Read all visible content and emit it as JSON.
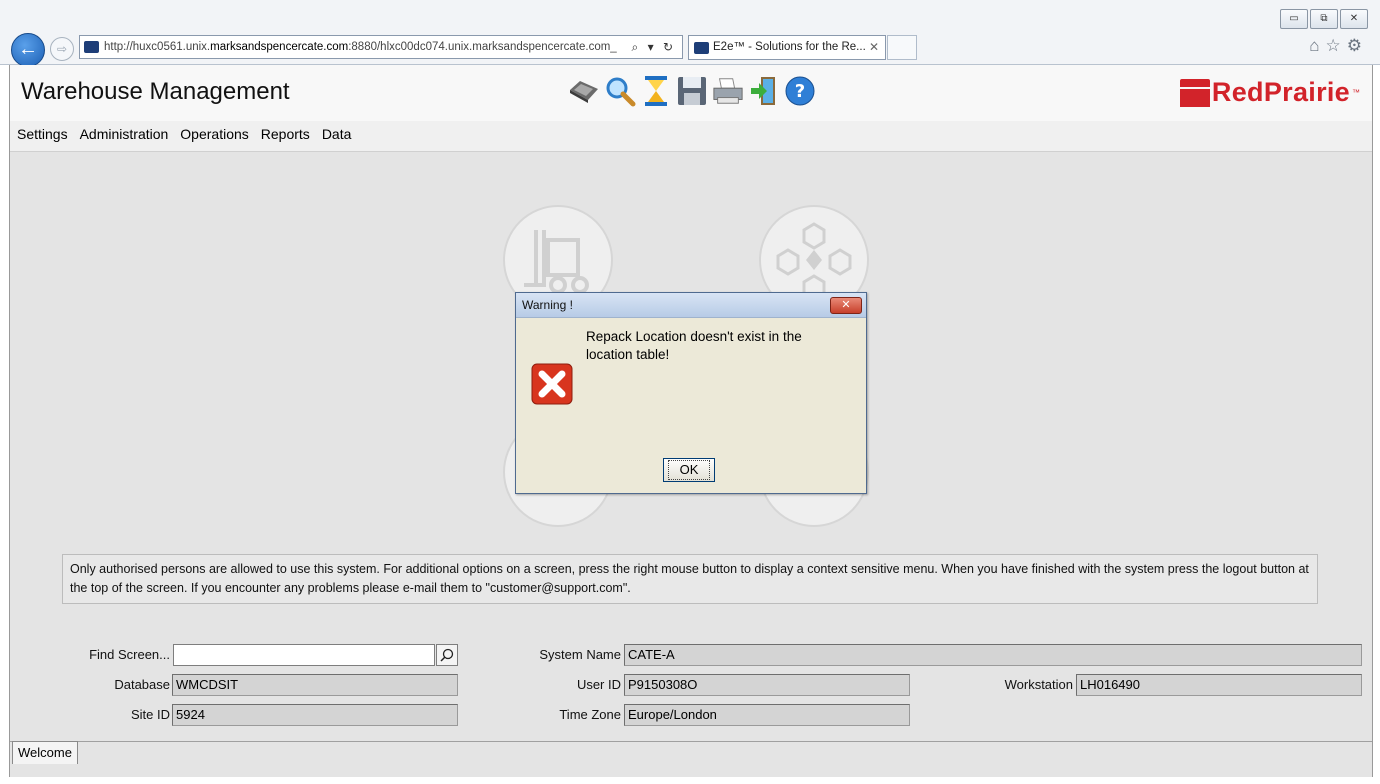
{
  "browser": {
    "url_prefix": "http://huxc0561.unix.",
    "url_domain": "marksandspencercate.com",
    "url_suffix": ":8880/hlxc00dc074.unix.marksandspencercate.com_",
    "address_tools": "⌕ ▾ ↻",
    "tab_title": "E2e™ - Solutions for the Re...",
    "tab_close": "✕",
    "window_buttons": [
      "▭",
      "⧉",
      "✕"
    ],
    "right_icons": [
      "home-icon",
      "star-icon",
      "gear-icon"
    ],
    "right_icons_glyphs": "⌂☆⚙"
  },
  "app": {
    "title": "Warehouse Management",
    "toolbar_icons": [
      "inbox-icon",
      "search-icon",
      "hourglass-icon",
      "save-icon",
      "print-icon",
      "logout-icon",
      "help-icon"
    ],
    "brand": "RedPrairie",
    "brand_tm": "™",
    "menu": [
      "Settings",
      "Administration",
      "Operations",
      "Reports",
      "Data"
    ]
  },
  "dialog": {
    "title": "Warning !",
    "close_label": "✕",
    "message": "Repack Location doesn't exist in the location table!",
    "ok_label": "OK",
    "icon": "error-icon"
  },
  "notice": "Only authorised persons are allowed to use this system.  For additional options on a screen, press the right mouse button to display a context sensitive menu.  When you have finished with the system press the logout button at the top of the screen.  If you encounter any problems please e-mail them to \"customer@support.com\".",
  "form": {
    "find_label": "Find Screen...",
    "find_value": "",
    "database_label": "Database",
    "database_value": "WMCDSIT",
    "site_label": "Site ID",
    "site_value": "5924",
    "system_name_label": "System Name",
    "system_name_value": "CATE-A",
    "user_label": "User ID",
    "user_value": "P9150308O",
    "timezone_label": "Time Zone",
    "timezone_value": "Europe/London",
    "workstation_label": "Workstation",
    "workstation_value": "LH016490"
  },
  "bottom_tab": "Welcome"
}
